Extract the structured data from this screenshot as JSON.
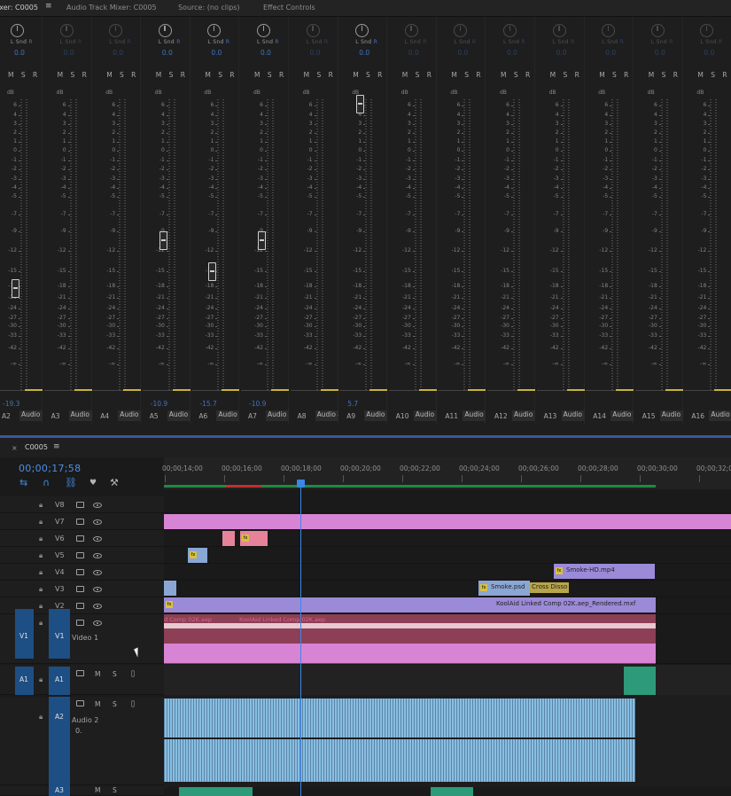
{
  "tabs": [
    {
      "label": "ixer: C0005",
      "active": true
    },
    {
      "label": "Audio Track Mixer: C0005",
      "active": false
    },
    {
      "label": "Source: (no clips)",
      "active": false
    },
    {
      "label": "Effect Controls",
      "active": false
    }
  ],
  "mixer": {
    "db_label": "dB",
    "pan_label_l": "L",
    "pan_label_mid": "Snd",
    "pan_label_r": "R",
    "msr": "M S R",
    "scale": [
      "6",
      "4",
      "3",
      "2",
      "1",
      "0",
      "-1",
      "-2",
      "-3",
      "-4",
      "-5",
      "-7",
      "-9",
      "-12",
      "-15",
      "-18",
      "-21",
      "-24",
      "-27",
      "-30",
      "-33",
      "-42",
      "-∞"
    ],
    "strips": [
      {
        "id": "A2",
        "name": "Audio 2",
        "pan": "0.0",
        "volume": "-19.3",
        "fader_db": -19.3,
        "active": true
      },
      {
        "id": "A3",
        "name": "Audio 3",
        "pan": "0.0",
        "volume": "",
        "fader_db": null,
        "active": false
      },
      {
        "id": "A4",
        "name": "Audio 4",
        "pan": "0.0",
        "volume": "",
        "fader_db": null,
        "active": false
      },
      {
        "id": "A5",
        "name": "Audio 5",
        "pan": "0.0",
        "volume": "-10.9",
        "fader_db": -10.9,
        "active": true
      },
      {
        "id": "A6",
        "name": "Audio 6",
        "pan": "0.0",
        "volume": "-15.7",
        "fader_db": -15.7,
        "active": true
      },
      {
        "id": "A7",
        "name": "Audio 7",
        "pan": "0.0",
        "volume": "-10.9",
        "fader_db": -10.9,
        "active": true
      },
      {
        "id": "A8",
        "name": "Audio 8",
        "pan": "0.0",
        "volume": "",
        "fader_db": null,
        "active": false
      },
      {
        "id": "A9",
        "name": "Audio 9",
        "pan": "0.0",
        "volume": "5.7",
        "fader_db": 5.7,
        "active": true
      },
      {
        "id": "A10",
        "name": "Audio 10",
        "pan": "0.0",
        "volume": "",
        "fader_db": null,
        "active": false
      },
      {
        "id": "A11",
        "name": "Audio 11",
        "pan": "0.0",
        "volume": "",
        "fader_db": null,
        "active": false
      },
      {
        "id": "A12",
        "name": "Audio 12",
        "pan": "0.0",
        "volume": "",
        "fader_db": null,
        "active": false
      },
      {
        "id": "A13",
        "name": "Audio 13",
        "pan": "0.0",
        "volume": "",
        "fader_db": null,
        "active": false
      },
      {
        "id": "A14",
        "name": "Audio 14",
        "pan": "0.0",
        "volume": "",
        "fader_db": null,
        "active": false
      },
      {
        "id": "A15",
        "name": "Audio 15",
        "pan": "0.0",
        "volume": "",
        "fader_db": null,
        "active": false
      },
      {
        "id": "A16",
        "name": "Audio 16",
        "pan": "0.0",
        "volume": "",
        "fader_db": null,
        "active": false
      }
    ]
  },
  "timeline": {
    "sequence": "C0005",
    "close": "×",
    "menu": "≡",
    "timecode": "00;00;17;58",
    "ruler": [
      "00;00;14;00",
      "00;00;16;00",
      "00;00;18;00",
      "00;00;20;00",
      "00;00;22;00",
      "00;00;24;00",
      "00;00;26;00",
      "00;00;28;00",
      "00;00;30;00",
      "00;00;32;00"
    ],
    "tracks": [
      {
        "name": "V8"
      },
      {
        "name": "V7"
      },
      {
        "name": "V6"
      },
      {
        "name": "V5"
      },
      {
        "name": "V4"
      },
      {
        "name": "V3"
      },
      {
        "name": "V2"
      },
      {
        "name": "V1"
      }
    ],
    "v1_src": "V1",
    "v1_name": "Video 1",
    "a1_src": "A1",
    "a1": "A1",
    "a2": "A2",
    "a2_name": "Audio 2",
    "a2_vol": "0.",
    "a3": "A3",
    "clips": {
      "smoke_hd": "Smoke-HD.mp4",
      "smoke_psd": "Smoke.psd",
      "cross_dissolve": "Cross Disso",
      "koolaid_rendered": "KoolAid Linked Comp 02K.aep_Rendered.mxf",
      "v1_comp_a": "d Comp 02K.aep",
      "v1_comp_b": "KoolAid Linked Comp 02K.aep"
    },
    "m_label": "M",
    "s_label": "S"
  },
  "colors": {
    "accent": "#3b87e6",
    "pink": "#d884d4",
    "purple": "#9b8ad8",
    "blue": "#8aa6d4",
    "maroon": "#8c3f55",
    "teal": "#2d9a7a"
  }
}
